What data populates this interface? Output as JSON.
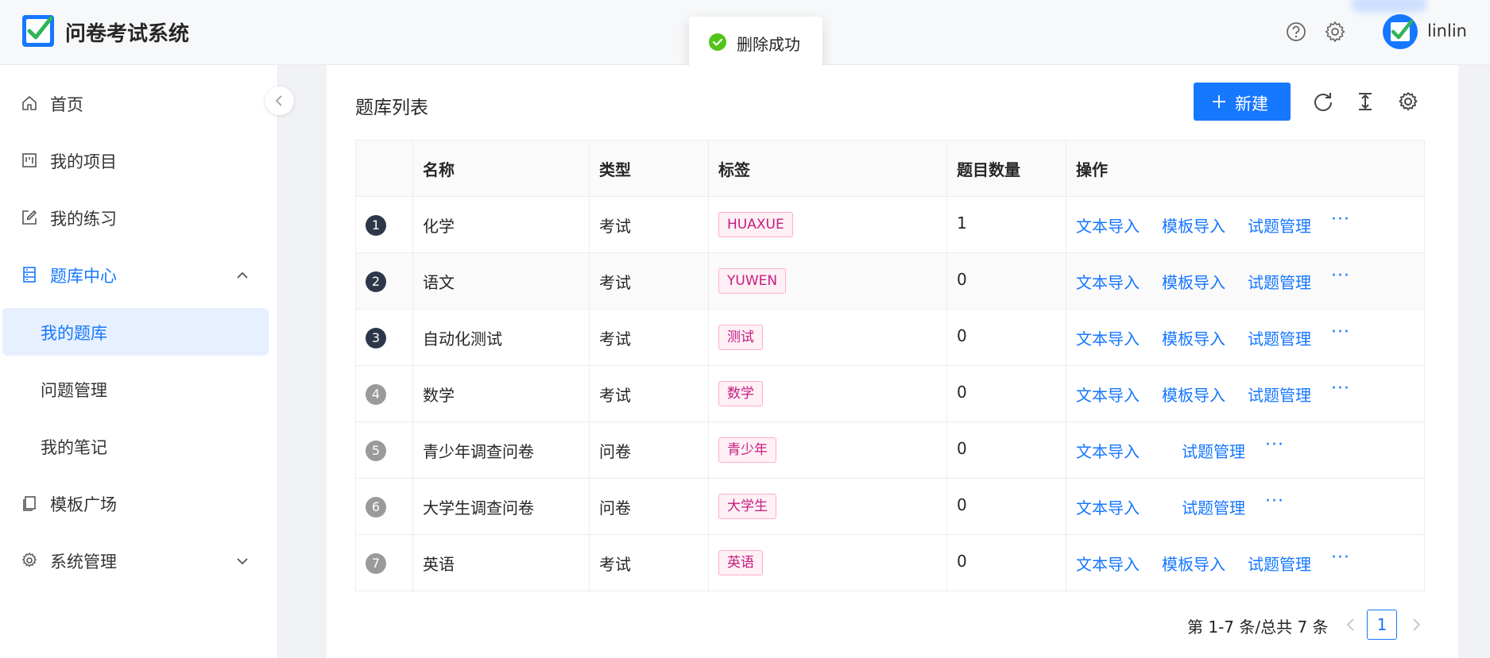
{
  "header": {
    "app_title": "问卷考试系统",
    "username": "linlin",
    "help_icon": "question-circle-icon",
    "settings_icon": "gear-icon"
  },
  "toast": {
    "text": "删除成功",
    "icon": "check-circle-icon"
  },
  "sidebar": {
    "items": [
      {
        "label": "首页",
        "icon": "home-icon"
      },
      {
        "label": "我的项目",
        "icon": "project-icon"
      },
      {
        "label": "我的练习",
        "icon": "edit-icon"
      },
      {
        "label": "题库中心",
        "icon": "database-icon",
        "expanded": true
      },
      {
        "label": "模板广场",
        "icon": "copy-icon"
      },
      {
        "label": "系统管理",
        "icon": "gear-icon",
        "expanded": false
      }
    ],
    "subitems": [
      {
        "label": "我的题库",
        "selected": true
      },
      {
        "label": "问题管理"
      },
      {
        "label": "我的笔记"
      }
    ]
  },
  "main": {
    "title": "题库列表",
    "new_button": "新建",
    "toolbar_icons": [
      "reload-icon",
      "column-height-icon",
      "setting-icon"
    ]
  },
  "table": {
    "columns": [
      "",
      "名称",
      "类型",
      "标签",
      "题目数量",
      "操作"
    ],
    "rows": [
      {
        "index": "1",
        "name": "化学",
        "type": "考试",
        "tag": "HUAXUE",
        "count": "1",
        "ops": [
          "文本导入",
          "模板导入",
          "试题管理"
        ],
        "more": "···"
      },
      {
        "index": "2",
        "name": "语文",
        "type": "考试",
        "tag": "YUWEN",
        "count": "0",
        "ops": [
          "文本导入",
          "模板导入",
          "试题管理"
        ],
        "more": "···"
      },
      {
        "index": "3",
        "name": "自动化测试",
        "type": "考试",
        "tag": "测试",
        "count": "0",
        "ops": [
          "文本导入",
          "模板导入",
          "试题管理"
        ],
        "more": "···"
      },
      {
        "index": "4",
        "name": "数学",
        "type": "考试",
        "tag": "数学",
        "count": "0",
        "ops": [
          "文本导入",
          "模板导入",
          "试题管理"
        ],
        "more": "···"
      },
      {
        "index": "5",
        "name": "青少年调查问卷",
        "type": "问卷",
        "tag": "青少年",
        "count": "0",
        "ops": [
          "文本导入",
          "试题管理"
        ],
        "more": "···"
      },
      {
        "index": "6",
        "name": "大学生调查问卷",
        "type": "问卷",
        "tag": "大学生",
        "count": "0",
        "ops": [
          "文本导入",
          "试题管理"
        ],
        "more": "···"
      },
      {
        "index": "7",
        "name": "英语",
        "type": "考试",
        "tag": "英语",
        "count": "0",
        "ops": [
          "文本导入",
          "模板导入",
          "试题管理"
        ],
        "more": "···"
      }
    ]
  },
  "pagination": {
    "summary": "第 1-7 条/总共 7 条",
    "current": "1"
  },
  "colors": {
    "primary": "#1677ff",
    "tag_text": "#c41d7f",
    "tag_bg": "#fff0f6",
    "success": "#52c41a"
  }
}
